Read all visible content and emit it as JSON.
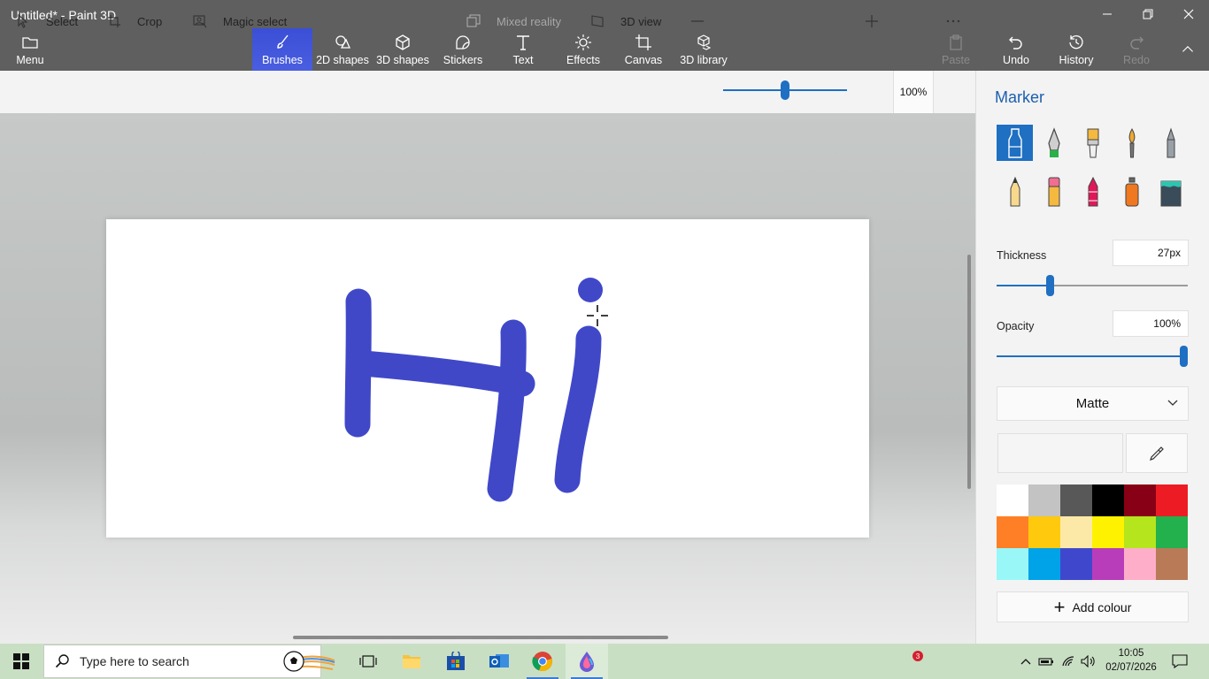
{
  "window": {
    "title": "Untitled* - Paint 3D"
  },
  "ribbon": {
    "menu": "Menu",
    "tabs": [
      {
        "label": "Brushes",
        "icon": "brush-icon"
      },
      {
        "label": "2D shapes",
        "icon": "2d-shapes-icon"
      },
      {
        "label": "3D shapes",
        "icon": "3d-shapes-icon"
      },
      {
        "label": "Stickers",
        "icon": "stickers-icon"
      },
      {
        "label": "Text",
        "icon": "text-icon"
      },
      {
        "label": "Effects",
        "icon": "effects-icon"
      },
      {
        "label": "Canvas",
        "icon": "canvas-icon"
      },
      {
        "label": "3D library",
        "icon": "3d-library-icon"
      }
    ],
    "paste": "Paste",
    "undo": "Undo",
    "history": "History",
    "redo": "Redo"
  },
  "toolbar": {
    "select": "Select",
    "crop": "Crop",
    "magic_select": "Magic select",
    "mixed_reality": "Mixed reality",
    "view_3d": "3D view",
    "zoom_value": "100%",
    "zoom_level": 0.5
  },
  "canvas": {
    "drawing_text": "Hi",
    "stroke_color": "#4048c8"
  },
  "panel": {
    "title": "Marker",
    "brushes": [
      "marker",
      "calligraphy-pen",
      "oil-brush",
      "watercolor",
      "pixel-pen",
      "pencil",
      "eraser",
      "crayon",
      "spray-can",
      "fill"
    ],
    "thickness_label": "Thickness",
    "thickness_value": "27px",
    "thickness_level": 0.27,
    "opacity_label": "Opacity",
    "opacity_value": "100%",
    "opacity_level": 1.0,
    "finish": "Matte",
    "add_colour": "Add colour",
    "palette": [
      "#ffffff",
      "#c3c3c3",
      "#585858",
      "#000000",
      "#880015",
      "#ed1c24",
      "#ff7f27",
      "#ffc90e",
      "#fde9a7",
      "#fff200",
      "#b5e61d",
      "#22b14c",
      "#99f7f7",
      "#00a2e8",
      "#3f48cc",
      "#b83dba",
      "#ffaec9",
      "#b97a57"
    ]
  },
  "taskbar": {
    "search_placeholder": "Type here to search",
    "badge_count": "3",
    "time": "10:05",
    "date": "02/07/2026"
  }
}
